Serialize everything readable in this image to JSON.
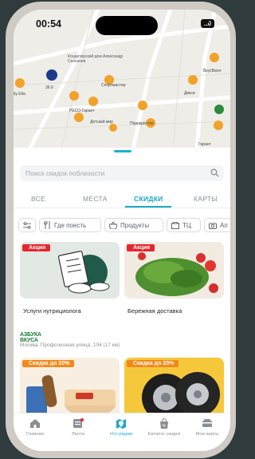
{
  "status_bar": {
    "time": "00:54",
    "battery": "20"
  },
  "map": {
    "labels": [
      "Кондитерский дом Александр Селезнев",
      "Спортмастер",
      "ВкусВилл",
      "Дикси",
      "РЕСО-Гарант",
      "Детский мир",
      "Перекрёсток",
      "Гарант",
      "ity Ella",
      "36.6"
    ]
  },
  "search": {
    "placeholder": "Поиск скидок поблизости"
  },
  "tabs": [
    {
      "label": "ВСЕ",
      "active": false
    },
    {
      "label": "МЕСТА",
      "active": false
    },
    {
      "label": "СКИДКИ",
      "active": true
    },
    {
      "label": "КАРТЫ",
      "active": false
    }
  ],
  "filters": [
    {
      "label": "",
      "icon": "filter-sliders-icon"
    },
    {
      "label": "Где поесть",
      "icon": "cutlery-icon"
    },
    {
      "label": "Продукты",
      "icon": "shopping-basket-icon"
    },
    {
      "label": "ТЦ",
      "icon": "mall-icon"
    },
    {
      "label": "Ап",
      "icon": "camera-icon"
    }
  ],
  "cards": [
    {
      "badge": "Акция",
      "title": "Услуги нутрициолога"
    },
    {
      "badge": "Акция",
      "title": "Бережная доставка"
    },
    {
      "badge": "Скидка до 20%",
      "title": ""
    },
    {
      "badge": "Скидка до 20%",
      "title": ""
    }
  ],
  "store": {
    "brand_line1": "АЗБУКА",
    "brand_line2": "ВКУСА",
    "address": "Москва, Профсоюзная улица, 104 (17 км)"
  },
  "bottom_nav": [
    {
      "label": "Главная",
      "icon": "home-icon",
      "active": false
    },
    {
      "label": "Лента",
      "icon": "feed-icon",
      "active": false
    },
    {
      "label": "Что рядом",
      "icon": "nearby-icon",
      "active": true
    },
    {
      "label": "Каталог скидок",
      "icon": "discount-bag-icon",
      "active": false
    },
    {
      "label": "Мои карты",
      "icon": "cards-icon",
      "active": false
    }
  ],
  "colors": {
    "accent": "#1aa9c6",
    "promo_red": "#e8252f",
    "promo_orange": "#f28a1a",
    "map_pin": "#f0a22a"
  }
}
